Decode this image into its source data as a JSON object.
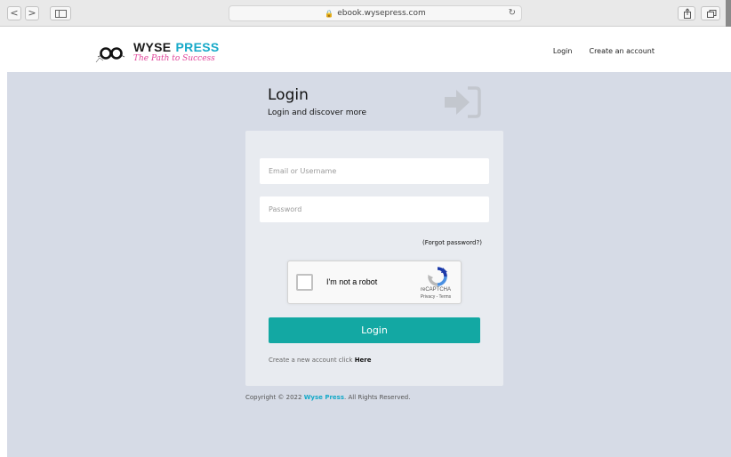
{
  "browser": {
    "url": "ebook.wysepress.com",
    "back_glyph": "<",
    "forward_glyph": ">"
  },
  "header": {
    "brand_part1": "WYSE",
    "brand_part2": "PRESS",
    "tagline": "The Path to Success",
    "nav": {
      "login": "Login",
      "create_account": "Create an account"
    }
  },
  "login": {
    "title": "Login",
    "subtitle": "Login and discover more",
    "email_placeholder": "Email or Username",
    "password_placeholder": "Password",
    "forgot": "(Forgot password?)",
    "captcha": {
      "label": "I'm not a robot",
      "brand": "reCAPTCHA",
      "links": "Privacy - Terms"
    },
    "submit": "Login",
    "create_prefix": "Create a new account click",
    "create_link": "Here"
  },
  "footer": {
    "prefix": "Copyright © 2022",
    "brand": "Wyse Press",
    "suffix": ". All Rights Reserved."
  },
  "colors": {
    "accent": "#13a8a3",
    "brand_blue": "#16a9c8",
    "tagline_pink": "#e0449a",
    "page_bg": "#d6dbe6",
    "card_bg": "#e8ebf0"
  },
  "icons": {
    "signin": "sign-in-arrow-icon",
    "lock": "lock-icon",
    "reload": "reload-icon",
    "share": "share-icon",
    "tabs": "tabs-icon"
  }
}
